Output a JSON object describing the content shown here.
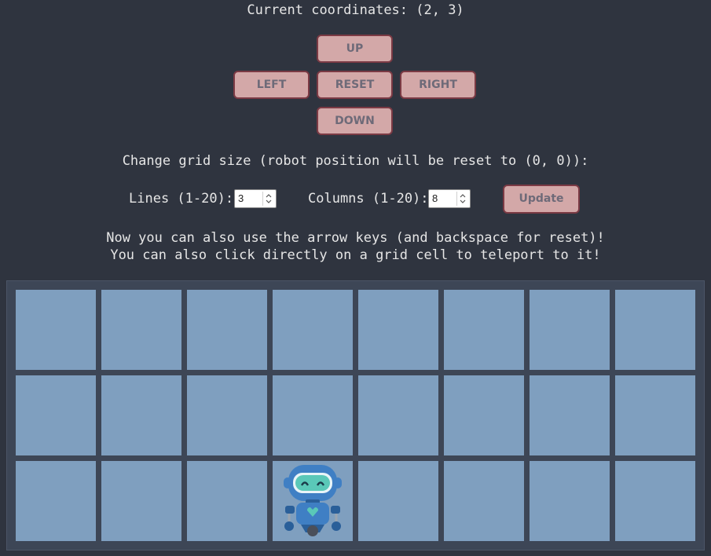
{
  "status": {
    "coordinates_text": "Current coordinates: (2, 3)"
  },
  "controls": {
    "up_label": "UP",
    "left_label": "LEFT",
    "reset_label": "RESET",
    "right_label": "RIGHT",
    "down_label": "DOWN"
  },
  "grid_settings": {
    "title": "Change grid size (robot position will be reset to (0, 0)):",
    "lines_label": "Lines (1-20):",
    "lines_value": "3",
    "columns_label": "Columns (1-20):",
    "columns_value": "8",
    "update_label": "Update"
  },
  "info": {
    "line1": "Now you can also use the arrow keys (and backspace for reset)!",
    "line2": "You can also click directly on a grid cell to teleport to it!"
  },
  "grid": {
    "rows": 3,
    "columns": 8,
    "robot_row": 2,
    "robot_col": 3,
    "cell_color": "#7f9fbf",
    "robot_icon": "robot-icon"
  },
  "colors": {
    "background": "#2f343f",
    "button_fill": "#d3a8a8",
    "button_border": "#7b3a44",
    "robot_body": "#3f7fc4"
  }
}
